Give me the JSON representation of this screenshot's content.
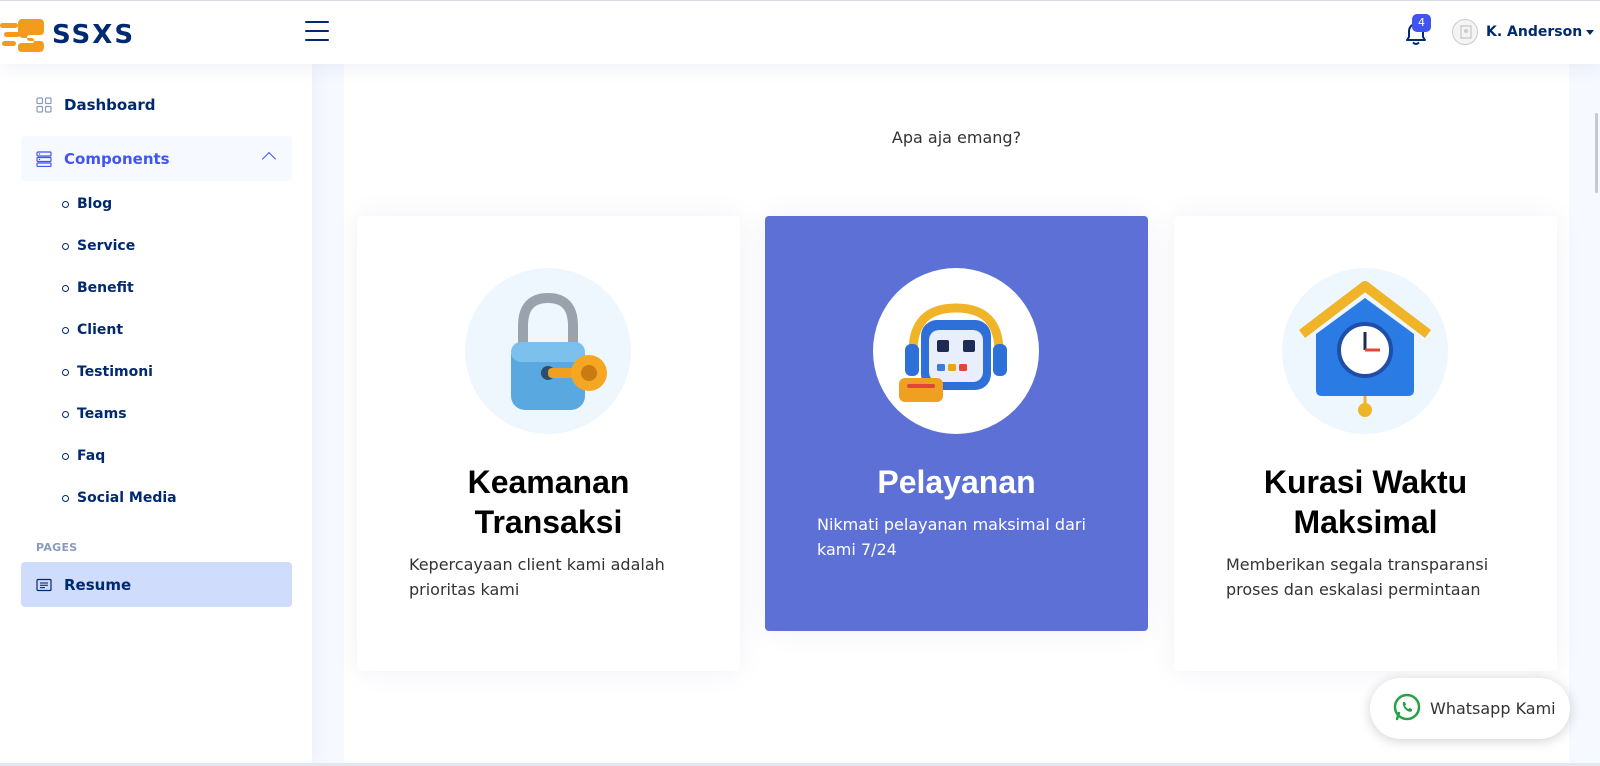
{
  "brand": {
    "name": "SSXS"
  },
  "header": {
    "notification_count": "4",
    "user_name": "K. Anderson"
  },
  "sidebar": {
    "dashboard": "Dashboard",
    "components": "Components",
    "sub_items": [
      "Blog",
      "Service",
      "Benefit",
      "Client",
      "Testimoni",
      "Teams",
      "Faq",
      "Social Media"
    ],
    "pages_heading": "PAGES",
    "resume": "Resume"
  },
  "main": {
    "tagline": "Apa aja emang?",
    "cards": [
      {
        "title_line1": "Keamanan",
        "title_line2": "Transaksi",
        "text_line1": "Kepercayaan client kami adalah",
        "text_line2": "prioritas kami"
      },
      {
        "title": "Pelayanan",
        "text_line1": "Nikmati pelayanan maksimal dari",
        "text_line2": "kami 7/24"
      },
      {
        "title_line1": "Kurasi Waktu",
        "title_line2": "Maksimal",
        "text_line1": "Memberikan segala transparansi",
        "text_line2": "proses dan eskalasi permintaan"
      }
    ]
  },
  "whatsapp": {
    "label": "Whatsapp Kami"
  },
  "colors": {
    "primary": "#4154f1",
    "navy": "#012970",
    "card_active": "#5c70d6",
    "accent_orange": "#f29b1d"
  }
}
